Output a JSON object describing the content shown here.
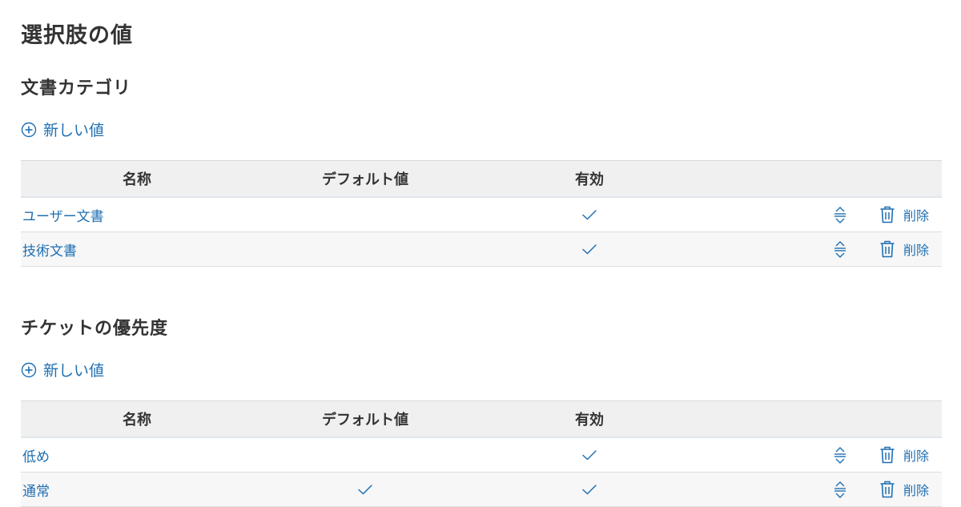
{
  "page": {
    "title": "選択肢の値"
  },
  "columns": {
    "name": "名称",
    "default": "デフォルト値",
    "enabled": "有効"
  },
  "new_value_label": "新しい値",
  "delete_label": "削除",
  "sections": [
    {
      "title": "文書カテゴリ",
      "rows": [
        {
          "name": "ユーザー文書",
          "is_default": false,
          "enabled": true
        },
        {
          "name": "技術文書",
          "is_default": false,
          "enabled": true
        }
      ]
    },
    {
      "title": "チケットの優先度",
      "rows": [
        {
          "name": "低め",
          "is_default": false,
          "enabled": true
        },
        {
          "name": "通常",
          "is_default": true,
          "enabled": true
        }
      ]
    }
  ],
  "colors": {
    "link": "#1f6fb2",
    "header_bg": "#f0f0f0",
    "alt_row_bg": "#f7f7f7",
    "check": "#1f6fb2"
  },
  "icons": {
    "add": "plus-circle-icon",
    "check": "check-icon",
    "reorder": "reorder-icon",
    "delete": "trash-icon"
  }
}
